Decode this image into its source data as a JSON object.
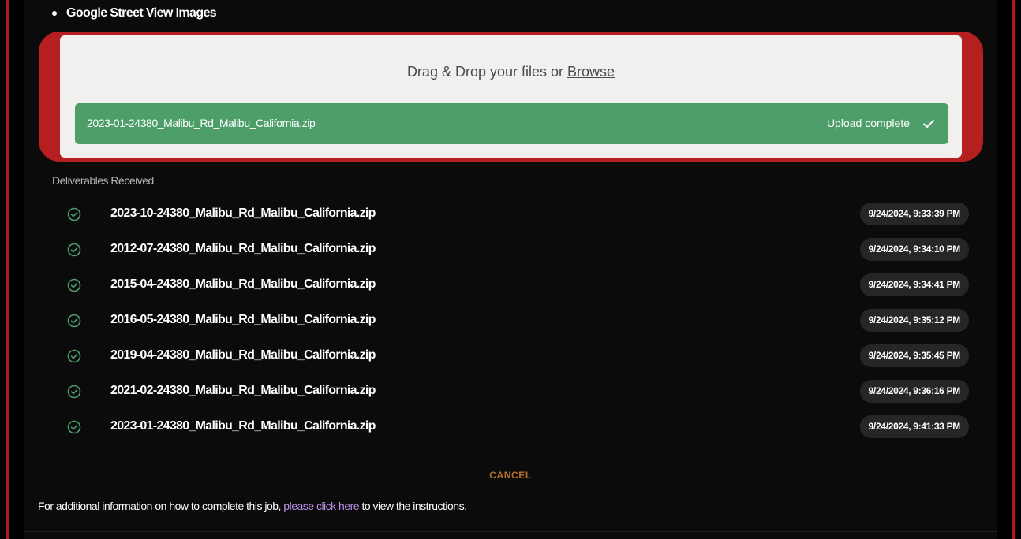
{
  "section": {
    "bullet_item": "Google Street View Images"
  },
  "uploader": {
    "drop_text": "Drag & Drop your files or ",
    "browse_label": "Browse",
    "file_name": "2023-01-24380_Malibu_Rd_Malibu_California.zip",
    "status": "Upload complete"
  },
  "deliverables": {
    "title": "Deliverables Received",
    "items": [
      {
        "name": "2023-10-24380_Malibu_Rd_Malibu_California.zip",
        "time": "9/24/2024, 9:33:39 PM"
      },
      {
        "name": "2012-07-24380_Malibu_Rd_Malibu_California.zip",
        "time": "9/24/2024, 9:34:10 PM"
      },
      {
        "name": "2015-04-24380_Malibu_Rd_Malibu_California.zip",
        "time": "9/24/2024, 9:34:41 PM"
      },
      {
        "name": "2016-05-24380_Malibu_Rd_Malibu_California.zip",
        "time": "9/24/2024, 9:35:12 PM"
      },
      {
        "name": "2019-04-24380_Malibu_Rd_Malibu_California.zip",
        "time": "9/24/2024, 9:35:45 PM"
      },
      {
        "name": "2021-02-24380_Malibu_Rd_Malibu_California.zip",
        "time": "9/24/2024, 9:36:16 PM"
      },
      {
        "name": "2023-01-24380_Malibu_Rd_Malibu_California.zip",
        "time": "9/24/2024, 9:41:33 PM"
      }
    ]
  },
  "actions": {
    "cancel_label": "CANCEL"
  },
  "footer": {
    "prefix": "For additional information on how to complete this job, ",
    "link_label": "please click here",
    "suffix": " to view the instructions."
  },
  "colors": {
    "accent_red": "#b51f1f",
    "success_green": "#4e9e6a",
    "cancel_orange": "#b3702b",
    "link_purple": "#b98fe6"
  },
  "icons": {
    "row_status": "check-circle-icon",
    "upload_status": "checkmark-icon"
  }
}
